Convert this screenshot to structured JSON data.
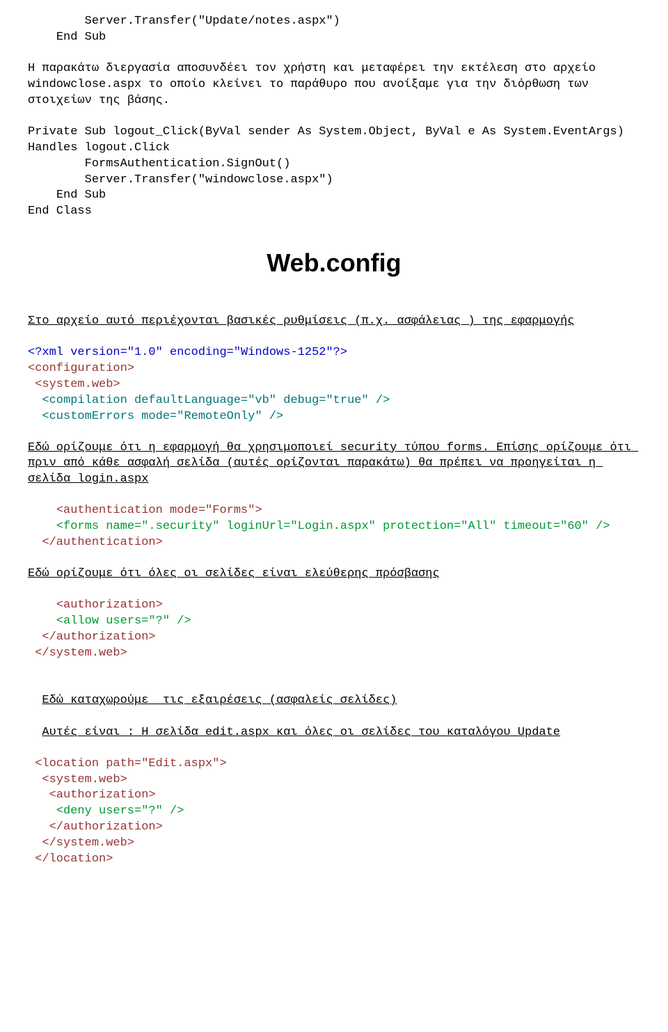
{
  "code1_line1": "        Server.Transfer(\"Update/notes.aspx\")",
  "code1_line2": "    End Sub",
  "para1": "Η παρακάτω διεργασία αποσυνδέει τον χρήστη και μεταφέρει την εκτέλεση στο αρχείο windowclose.aspx το οποίο κλείνει το παράθυρο που ανοίξαμε για την διόρθωση των στοιχείων της βάσης.",
  "code2_l1": "Private Sub logout_Click(ByVal sender As System.Object, ByVal e As System.EventArgs) Handles logout.Click",
  "code2_l2": "        FormsAuthentication.SignOut()",
  "code2_l3": "        Server.Transfer(\"windowclose.aspx\")",
  "code2_blank": "",
  "code2_l4": "    End Sub",
  "code2_l5": "End Class",
  "heading": "Web.config",
  "para2": "Στο αρχείο αυτό περιέχονται βασικές ρυθμίσεις (π.χ. ασφάλειας ) της εφαρμογής",
  "xml_decl": "<?xml version=\"1.0\" encoding=\"Windows-1252\"?>",
  "cfg_open": "<configuration>",
  "sysweb_open": " <system.web>",
  "compilation": "  <compilation defaultLanguage=\"vb\" debug=\"true\" />",
  "customerrors": "  <customErrors mode=\"RemoteOnly\" />",
  "para3": "Εδώ ορίζουμε ότι η εφαρμογή θα χρησιμοποιεί security τύπου forms. Επίσης ορίζουμε ότι πριν από κάθε ασφαλή σελίδα (αυτές ορίζονται παρακάτω) θα πρέπει να προηγείται η σελίδα login.aspx",
  "auth_open": "    <authentication mode=\"Forms\">",
  "forms_tag": "    <forms name=\".security\" loginUrl=\"Login.aspx\" protection=\"All\" timeout=\"60\" />",
  "auth_close": "  </authentication>",
  "para4": "Εδώ ορίζουμε ότι όλες οι σελίδες είναι ελεύθερης πρόσβασης",
  "authz_open": "    <authorization>",
  "allow": "    <allow users=\"?\" />",
  "authz_close": "  </authorization>",
  "sysweb_close": " </system.web>",
  "para5a": "Εδώ καταχωρούμε  τις εξαιρέσεις (ασφαλείς σελίδες)",
  "para5b": "Αυτές είναι : Η σελίδα edit.aspx και όλες οι σελίδες του καταλόγου Update",
  "loc_open": " <location path=\"Edit.aspx\">",
  "loc_sysweb_open": "  <system.web>",
  "loc_authz_open": "   <authorization>",
  "loc_deny": "    <deny users=\"?\" />",
  "loc_authz_close": "   </authorization>",
  "loc_sysweb_close": "  </system.web>",
  "loc_close": " </location>"
}
